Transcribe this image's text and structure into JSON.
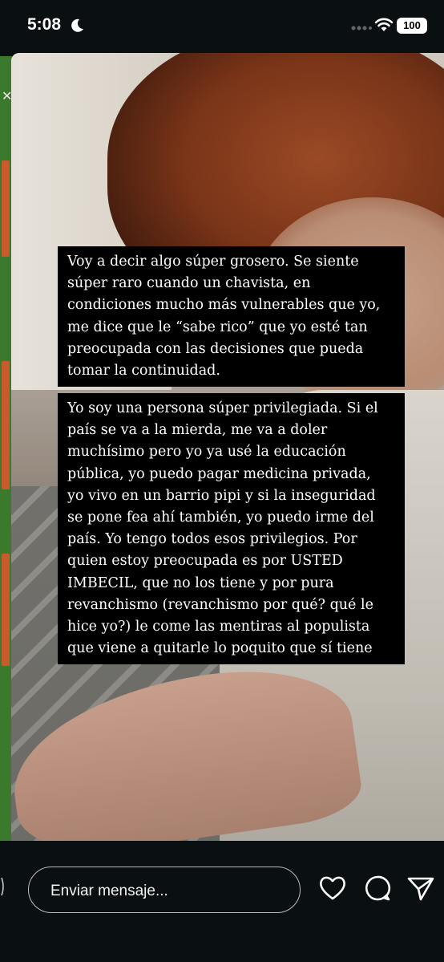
{
  "status_bar": {
    "time": "5:08",
    "battery": "100"
  },
  "story": {
    "caption_1": [
      "Voy a decir algo súper grosero. Se siente",
      "súper raro cuando un chavista, en",
      "condiciones mucho más vulnerables que yo,",
      "me dice que le “sabe rico” que yo esté tan",
      "preocupada con las decisiones que pueda",
      "tomar la continuidad."
    ],
    "caption_2": [
      "Yo soy una persona súper privilegiada. Si el",
      "país se va a la mierda, me va a doler",
      "muchísimo pero yo ya usé la educación",
      "pública, yo puedo pagar medicina privada,",
      "yo vivo en un barrio pipi y si la inseguridad",
      "se pone fea ahí también, yo puedo irme del",
      "país. Yo tengo todos esos privilegios. Por",
      "quien estoy preocupada es por USTED",
      "IMBECIL, que no los tiene y por pura",
      "revanchismo (revanchismo por qué? qué le",
      "hice yo?) le come las mentiras al populista",
      "que viene a quitarle lo poquito que sí tiene"
    ]
  },
  "bottom_bar": {
    "message_placeholder": "Enviar mensaje..."
  },
  "icons": {
    "moon": "moon-icon",
    "wifi": "wifi-icon",
    "heart": "heart-icon",
    "reply": "message-bubble-icon",
    "send": "send-icon"
  },
  "colors": {
    "background": "#0a1012",
    "caption_bg": "#000000",
    "left_strip": "#3b7a2c"
  }
}
